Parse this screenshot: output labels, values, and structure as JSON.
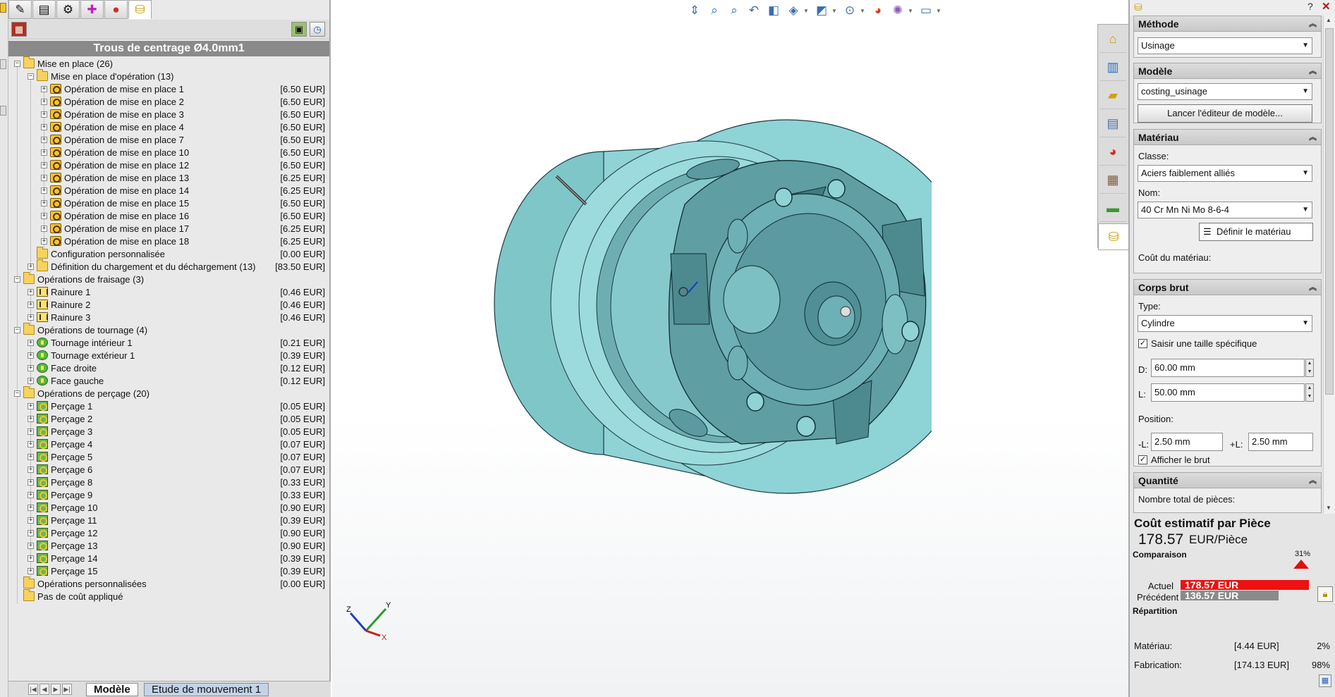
{
  "left_panel": {
    "header": "Trous de centrage Ø4.0mm1",
    "tree": [
      {
        "label": "Mise en place (26)",
        "cost": "",
        "level": 0,
        "icon": "folder-icon"
      },
      {
        "label": "Mise en place d'opération (13)",
        "cost": "",
        "level": 1,
        "icon": "folder-icon"
      },
      {
        "label": "Opération de mise en place 1",
        "cost": "[6.50 EUR]",
        "level": 2,
        "icon": "setup-op-icon"
      },
      {
        "label": "Opération de mise en place 2",
        "cost": "[6.50 EUR]",
        "level": 2,
        "icon": "setup-op-icon"
      },
      {
        "label": "Opération de mise en place 3",
        "cost": "[6.50 EUR]",
        "level": 2,
        "icon": "setup-op-icon"
      },
      {
        "label": "Opération de mise en place 4",
        "cost": "[6.50 EUR]",
        "level": 2,
        "icon": "setup-op-icon"
      },
      {
        "label": "Opération de mise en place 7",
        "cost": "[6.50 EUR]",
        "level": 2,
        "icon": "setup-op-icon"
      },
      {
        "label": "Opération de mise en place 10",
        "cost": "[6.50 EUR]",
        "level": 2,
        "icon": "setup-op-icon"
      },
      {
        "label": "Opération de mise en place 12",
        "cost": "[6.50 EUR]",
        "level": 2,
        "icon": "setup-op-icon"
      },
      {
        "label": "Opération de mise en place 13",
        "cost": "[6.25 EUR]",
        "level": 2,
        "icon": "setup-op-icon"
      },
      {
        "label": "Opération de mise en place 14",
        "cost": "[6.25 EUR]",
        "level": 2,
        "icon": "setup-op-icon"
      },
      {
        "label": "Opération de mise en place 15",
        "cost": "[6.50 EUR]",
        "level": 2,
        "icon": "setup-op-icon"
      },
      {
        "label": "Opération de mise en place 16",
        "cost": "[6.50 EUR]",
        "level": 2,
        "icon": "setup-op-icon"
      },
      {
        "label": "Opération de mise en place 17",
        "cost": "[6.25 EUR]",
        "level": 2,
        "icon": "setup-op-icon"
      },
      {
        "label": "Opération de mise en place 18",
        "cost": "[6.25 EUR]",
        "level": 2,
        "icon": "setup-op-icon"
      },
      {
        "label": "Configuration personnalisée",
        "cost": "[0.00 EUR]",
        "level": 1,
        "icon": "folder-icon",
        "noexp": true
      },
      {
        "label": "Définition du chargement et du déchargement (13)",
        "cost": "[83.50 EUR]",
        "level": 1,
        "icon": "folder-icon"
      },
      {
        "label": "Opérations de fraisage (3)",
        "cost": "",
        "level": 0,
        "icon": "folder-icon"
      },
      {
        "label": "Rainure 1",
        "cost": "[0.46 EUR]",
        "level": 1,
        "icon": "milling-icon"
      },
      {
        "label": "Rainure 2",
        "cost": "[0.46 EUR]",
        "level": 1,
        "icon": "milling-icon"
      },
      {
        "label": "Rainure 3",
        "cost": "[0.46 EUR]",
        "level": 1,
        "icon": "milling-icon"
      },
      {
        "label": "Opérations de tournage (4)",
        "cost": "",
        "level": 0,
        "icon": "folder-icon"
      },
      {
        "label": "Tournage intérieur 1",
        "cost": "[0.21 EUR]",
        "level": 1,
        "icon": "turning-icon"
      },
      {
        "label": "Tournage extérieur 1",
        "cost": "[0.39 EUR]",
        "level": 1,
        "icon": "turning-icon"
      },
      {
        "label": "Face droite",
        "cost": "[0.12 EUR]",
        "level": 1,
        "icon": "turning-icon"
      },
      {
        "label": "Face gauche",
        "cost": "[0.12 EUR]",
        "level": 1,
        "icon": "turning-icon"
      },
      {
        "label": "Opérations de perçage (20)",
        "cost": "",
        "level": 0,
        "icon": "folder-icon"
      },
      {
        "label": "Perçage 1",
        "cost": "[0.05 EUR]",
        "level": 1,
        "icon": "drilling-icon"
      },
      {
        "label": "Perçage 2",
        "cost": "[0.05 EUR]",
        "level": 1,
        "icon": "drilling-icon"
      },
      {
        "label": "Perçage 3",
        "cost": "[0.05 EUR]",
        "level": 1,
        "icon": "drilling-icon"
      },
      {
        "label": "Perçage 4",
        "cost": "[0.07 EUR]",
        "level": 1,
        "icon": "drilling-icon"
      },
      {
        "label": "Perçage 5",
        "cost": "[0.07 EUR]",
        "level": 1,
        "icon": "drilling-icon"
      },
      {
        "label": "Perçage 6",
        "cost": "[0.07 EUR]",
        "level": 1,
        "icon": "drilling-icon"
      },
      {
        "label": "Perçage 8",
        "cost": "[0.33 EUR]",
        "level": 1,
        "icon": "drilling-icon"
      },
      {
        "label": "Perçage 9",
        "cost": "[0.33 EUR]",
        "level": 1,
        "icon": "drilling-icon"
      },
      {
        "label": "Perçage 10",
        "cost": "[0.90 EUR]",
        "level": 1,
        "icon": "drilling-icon"
      },
      {
        "label": "Perçage 11",
        "cost": "[0.39 EUR]",
        "level": 1,
        "icon": "drilling-icon"
      },
      {
        "label": "Perçage 12",
        "cost": "[0.90 EUR]",
        "level": 1,
        "icon": "drilling-icon"
      },
      {
        "label": "Perçage 13",
        "cost": "[0.90 EUR]",
        "level": 1,
        "icon": "drilling-icon"
      },
      {
        "label": "Perçage 14",
        "cost": "[0.39 EUR]",
        "level": 1,
        "icon": "drilling-icon"
      },
      {
        "label": "Perçage 15",
        "cost": "[0.39 EUR]",
        "level": 1,
        "icon": "drilling-icon"
      },
      {
        "label": "Opérations personnalisées",
        "cost": "[0.00 EUR]",
        "level": 0,
        "icon": "folder-icon",
        "noexp": true
      },
      {
        "label": "Pas de coût appliqué",
        "cost": "",
        "level": 0,
        "icon": "folder-icon",
        "noexp": true
      }
    ],
    "bottom_tabs": {
      "model": "Modèle",
      "motion": "Etude de mouvement 1"
    }
  },
  "viewport": {
    "toolbar_icons": [
      "standard-views-icon",
      "zoom-to-fit-icon",
      "zoom-area-icon",
      "previous-view-icon",
      "section-view-icon",
      "view-orientation-icon",
      "display-style-icon",
      "hide-show-items-icon",
      "edit-appearance-icon",
      "apply-scene-icon",
      "view-settings-icon"
    ],
    "triad": {
      "x": "X",
      "y": "Y",
      "z": "Z"
    }
  },
  "task_tabs": [
    "home-icon",
    "resources-icon",
    "file-explorer-icon",
    "view-palette-icon",
    "appearances-icon",
    "custom-properties-icon",
    "design-library-icon",
    "costing-icon"
  ],
  "right_panel": {
    "method": {
      "title": "Méthode",
      "value": "Usinage"
    },
    "model": {
      "title": "Modèle",
      "value": "costing_usinage",
      "button": "Lancer l'éditeur de modèle..."
    },
    "material": {
      "title": "Matériau",
      "class_label": "Classe:",
      "class_value": "Aciers faiblement alliés",
      "name_label": "Nom:",
      "name_value": "40 Cr Mn Ni Mo 8-6-4",
      "define_button": "Définir le matériau",
      "cost_label": "Coût du matériau:"
    },
    "stock": {
      "title": "Corps brut",
      "type_label": "Type:",
      "type_value": "Cylindre",
      "specific_size_label": "Saisir une taille spécifique",
      "specific_size_checked": true,
      "d_label": "D:",
      "d_value": "60.00 mm",
      "l_label": "L:",
      "l_value": "50.00 mm",
      "position_label": "Position:",
      "minus_l_label": "-L:",
      "minus_l_value": "2.50 mm",
      "plus_l_label": "+L:",
      "plus_l_value": "2.50 mm",
      "show_stock_label": "Afficher le brut",
      "show_stock_checked": true
    },
    "quantity": {
      "title": "Quantité",
      "total_label": "Nombre total de pièces:"
    },
    "estimate": {
      "title": "Coût estimatif par Pièce",
      "value": "178.57",
      "unit": "EUR/Pièce",
      "comparison_label": "Comparaison",
      "change_percent": "31%",
      "current_label": "Actuel",
      "current_value": "178.57 EUR",
      "previous_label": "Précédent",
      "previous_value": "136.57 EUR",
      "current_fraction": 1.0,
      "previous_fraction": 0.765,
      "breakdown_label": "Répartition",
      "material_label": "Matériau:",
      "material_cost": "[4.44 EUR]",
      "material_pct": "2%",
      "manufacturing_label": "Fabrication:",
      "manufacturing_cost": "[174.13 EUR]",
      "manufacturing_pct": "98%"
    }
  },
  "colors": {
    "part_body": "#8fd3d6",
    "part_dark": "#5a9aa0",
    "accent_red": "#ee1111",
    "header_gray": "#8a8a8a"
  }
}
